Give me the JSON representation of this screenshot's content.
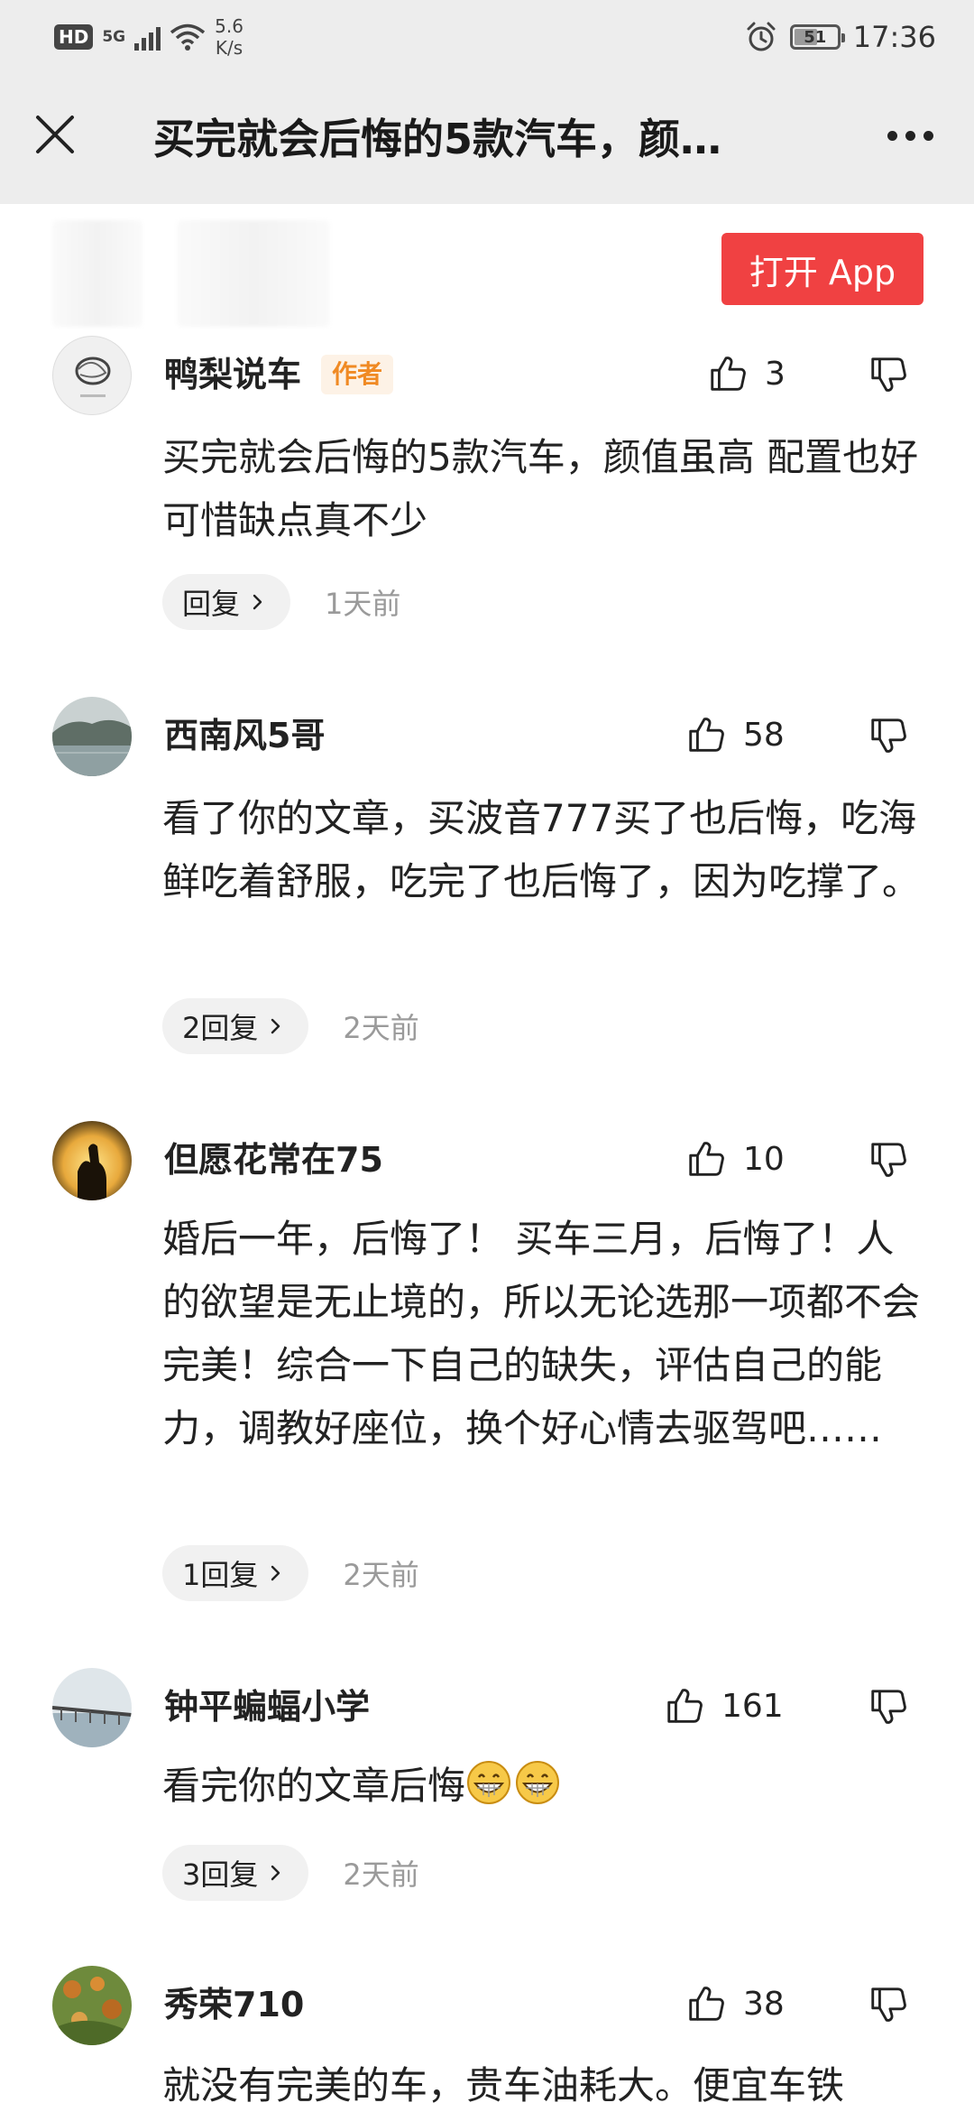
{
  "status_bar": {
    "hd": "HD",
    "network": "5G",
    "speed_value": "5.6",
    "speed_unit": "K/s",
    "battery": "51",
    "time": "17:36"
  },
  "header": {
    "title": "买完就会后悔的5款汽车，颜…",
    "open_app": "打开 App"
  },
  "comments": [
    {
      "author": "鸭梨说车",
      "badge": "作者",
      "likes": "3",
      "text": "买完就会后悔的5款汽车，颜值虽高 配置也好 可惜缺点真不少",
      "reply": "回复",
      "time": "1天前"
    },
    {
      "author": "西南风5哥",
      "likes": "58",
      "text": "看了你的文章，买波音777买了也后悔，吃海鲜吃着舒服，吃完了也后悔了，因为吃撑了。",
      "reply": "2回复",
      "time": "2天前"
    },
    {
      "author": "但愿花常在75",
      "likes": "10",
      "text": "婚后一年，后悔了！ 买车三月，后悔了！人的欲望是无止境的，所以无论选那一项都不会完美！综合一下自己的缺失，评估自己的能力，调教好座位，换个好心情去驱驾吧……",
      "reply": "1回复",
      "time": "2天前"
    },
    {
      "author": "钟平蝙蝠小学",
      "likes": "161",
      "text": "看完你的文章后悔",
      "reply": "3回复",
      "time": "2天前"
    },
    {
      "author": "秀荣710",
      "likes": "38",
      "text": "就没有完美的车，贵车油耗大。便宜车铁"
    }
  ],
  "colors": {
    "header_bg": "#ededed",
    "open_app_bg": "#f04142",
    "author_badge": "#f08a24",
    "time_text": "#9a9a9a",
    "reply_bg": "#f1f1f1"
  },
  "icons": {
    "close": "close-icon",
    "more": "more-icon",
    "like": "thumbs-up-icon",
    "dislike": "thumbs-down-icon",
    "reply_arrow": "chevron-right-icon",
    "emoji": "grinning-emoji-icon"
  }
}
